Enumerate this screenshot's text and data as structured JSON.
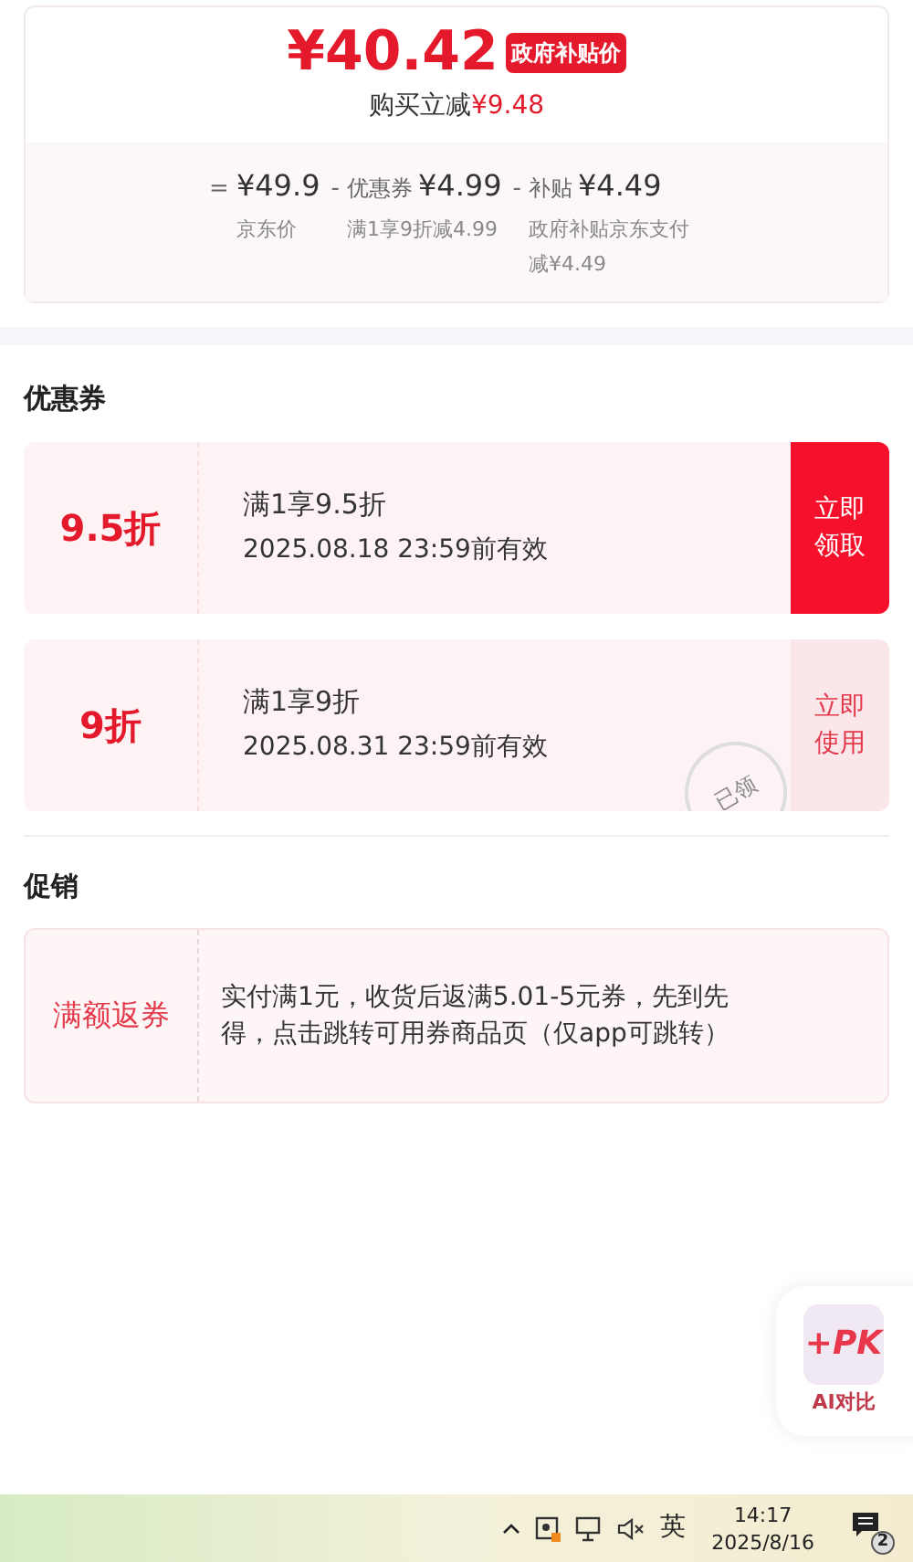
{
  "price_card": {
    "price": "¥40.42",
    "badge": "政府补贴价",
    "saving_label": "购买立减",
    "saving_value": "¥9.48",
    "breakdown": [
      {
        "operator": "=",
        "amount": "¥49.9",
        "note": "京东价"
      },
      {
        "operator": "-",
        "label": "优惠券",
        "amount": "¥4.99",
        "note": "满1享9折减4.99"
      },
      {
        "operator": "-",
        "label": "补贴",
        "amount": "¥4.49",
        "note": "政府补贴京东支付减¥4.49"
      }
    ]
  },
  "coupons": {
    "title": "优惠券",
    "items": [
      {
        "discount": "9.5折",
        "condition": "满1享9.5折",
        "validity": "2025.08.18 23:59前有效",
        "action": "立即领取",
        "claimed": false
      },
      {
        "discount": "9折",
        "condition": "满1享9折",
        "validity": "2025.08.31 23:59前有效",
        "action": "立即使用",
        "claimed": true,
        "stamp": "已领"
      }
    ]
  },
  "promotions": {
    "title": "促销",
    "items": [
      {
        "tag": "满额返券",
        "description": "实付满1元，收货后返满5.01-5元券，先到先得，点击跳转可用券商品页（仅app可跳转）"
      }
    ]
  },
  "ai_compare": {
    "logo": "+PK",
    "label": "AI对比"
  },
  "taskbar": {
    "ime": "英",
    "time": "14:17",
    "date": "2025/8/16",
    "notifications": "2"
  }
}
